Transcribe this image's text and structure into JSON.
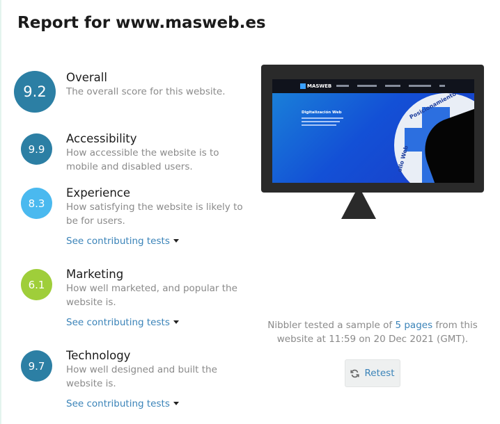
{
  "report": {
    "title_prefix": "Report for ",
    "site": "www.masweb.es"
  },
  "scores": {
    "overall": {
      "value": "9.2",
      "name": "Overall",
      "desc": "The overall score for this website.",
      "color": "#2c7fa4"
    },
    "accessibility": {
      "value": "9.9",
      "name": "Accessibility",
      "desc": "How accessible the website is to mobile and disabled users.",
      "color": "#2c7fa4"
    },
    "experience": {
      "value": "8.3",
      "name": "Experience",
      "desc": "How satisfying the website is likely to be for users.",
      "color": "#4ab9ef",
      "link": "See contributing tests"
    },
    "marketing": {
      "value": "6.1",
      "name": "Marketing",
      "desc": "How well marketed, and popular the website is.",
      "color": "#9fce3a",
      "link": "See contributing tests"
    },
    "technology": {
      "value": "9.7",
      "name": "Technology",
      "desc": "How well designed and built the website is.",
      "color": "#2c7fa4",
      "link": "See contributing tests"
    }
  },
  "screenshot": {
    "logo": "MASWEB",
    "hero": "Digitalización Web",
    "arc": "Posicionamiento Web",
    "arc2": "ollo Web"
  },
  "test_info": {
    "prefix": "Nibbler tested a sample of ",
    "pages": "5 pages",
    "suffix": " from this website at 11:59 on 20 Dec 2021 (GMT)."
  },
  "retest": {
    "label": "Retest",
    "icon": "refresh-icon"
  }
}
